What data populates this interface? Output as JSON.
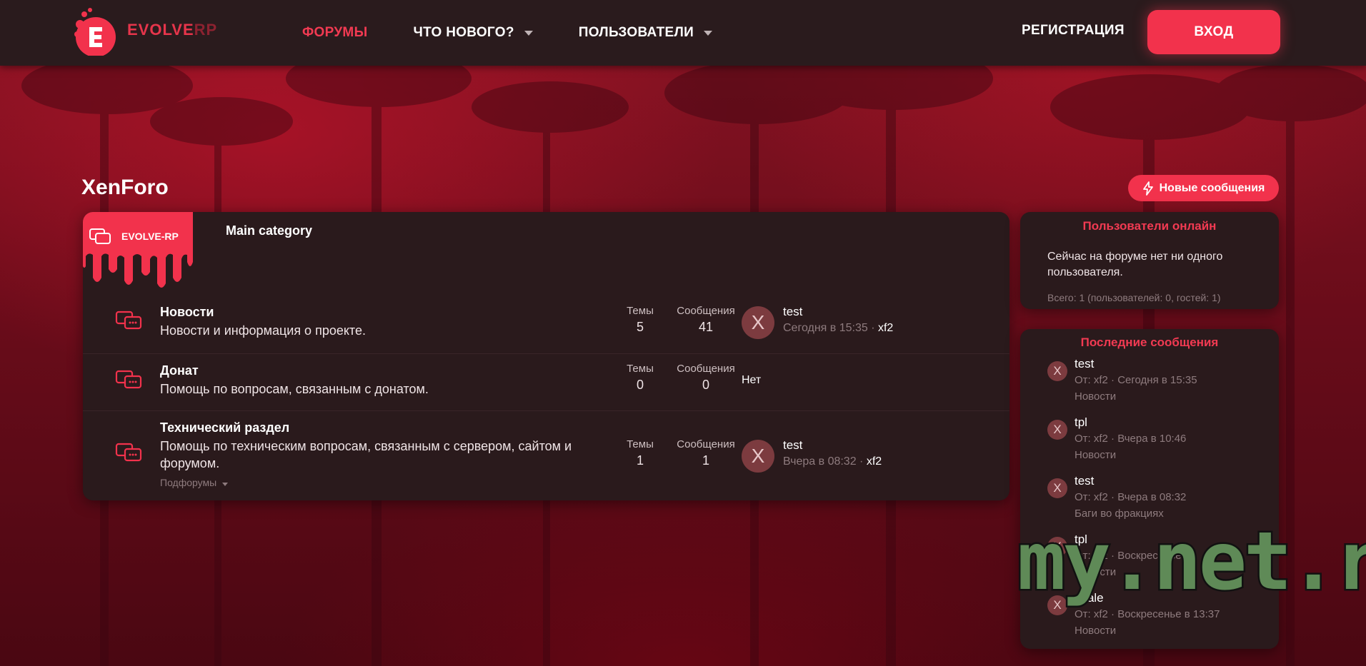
{
  "header": {
    "logo_text_main": "EVOLVE",
    "logo_text_accent": "RP",
    "nav": [
      {
        "label": "ФОРУМЫ",
        "active": true,
        "dropdown": false
      },
      {
        "label": "ЧТО НОВОГО?",
        "active": false,
        "dropdown": true
      },
      {
        "label": "ПОЛЬЗОВАТЕЛИ",
        "active": false,
        "dropdown": true
      }
    ],
    "register_label": "РЕГИСТРАЦИЯ",
    "login_label": "ВХОД"
  },
  "page": {
    "title": "XenForo",
    "new_posts_label": "Новые сообщения"
  },
  "category": {
    "banner_text": "EVOLVE-RP",
    "title": "Main category",
    "nodes": [
      {
        "title": "Новости",
        "description": "Новости и информация о проекте.",
        "threads_label": "Темы",
        "threads": "5",
        "messages_label": "Сообщения",
        "messages": "41",
        "last_avatar": "X",
        "last_title": "test",
        "last_time": "Сегодня в 15:35 ·",
        "last_user": "xf2"
      },
      {
        "title": "Донат",
        "description": "Помощь по вопросам, связанным с донатом.",
        "threads_label": "Темы",
        "threads": "0",
        "messages_label": "Сообщения",
        "messages": "0",
        "none_label": "Нет"
      },
      {
        "title": "Технический раздел",
        "description": "Помощь по техническим вопросам, связанным с сервером, сайтом и форумом.",
        "subforums_label": "Подфорумы",
        "threads_label": "Темы",
        "threads": "1",
        "messages_label": "Сообщения",
        "messages": "1",
        "last_avatar": "X",
        "last_title": "test",
        "last_time": "Вчера в 08:32 ·",
        "last_user": "xf2"
      }
    ]
  },
  "sidebar": {
    "online": {
      "title": "Пользователи онлайн",
      "text": "Сейчас на форуме нет ни одного пользователя.",
      "total": "Всего: 1 (пользователей: 0, гостей: 1)"
    },
    "latest": {
      "title": "Последние сообщения",
      "posts": [
        {
          "avatar": "X",
          "title": "test",
          "meta": "От: xf2 · Сегодня в 15:35",
          "forum": "Новости"
        },
        {
          "avatar": "X",
          "title": "tpl",
          "meta": "От: xf2 · Вчера в 10:46",
          "forum": "Новости"
        },
        {
          "avatar": "X",
          "title": "test",
          "meta": "От: xf2 · Вчера в 08:32",
          "forum": "Баги во фракциях"
        },
        {
          "avatar": "X",
          "title": "tpl",
          "meta": "От: xf2 · Воскресенье в",
          "forum": "Новости"
        },
        {
          "avatar": "X",
          "title": "eyale",
          "meta": "От: xf2 · Воскресенье в 13:37",
          "forum": "Новости"
        }
      ]
    }
  },
  "watermark": "my.net.ru",
  "colors": {
    "accent": "#f2324c",
    "header_bg": "#2a1b1d",
    "panel_bg": "#2a1a1c",
    "muted_text": "#8e7b7e"
  },
  "icons": [
    "logo-mark-icon",
    "chevron-down-icon",
    "lightning-icon",
    "forum-chat-icon",
    "avatar-letter-icon"
  ]
}
